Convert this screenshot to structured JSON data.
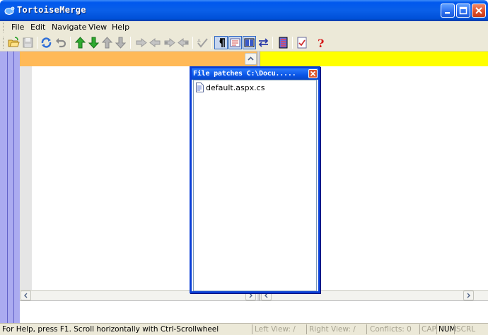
{
  "window": {
    "title": "TortoiseMerge"
  },
  "menu": {
    "items": [
      "File",
      "Edit",
      "Navigate",
      "View",
      "Help"
    ]
  },
  "toolbar": {
    "buttons": [
      "open-icon",
      "save-icon",
      "reload-icon",
      "undo-icon",
      "next-diff-icon",
      "prev-diff-icon",
      "next-conflict-icon",
      "prev-conflict-icon",
      "use-theirs-icon",
      "use-mine-icon",
      "use-theirs-before-mine-icon",
      "use-mine-before-theirs-icon",
      "mark-resolved-icon",
      "whitespace-icon",
      "inline-diff-icon",
      "two-pane-icon",
      "swap-icon",
      "settings-icon",
      "patch-list-icon",
      "help-icon"
    ]
  },
  "patch_window": {
    "title": "File patches  C:\\Docu.....",
    "files": [
      "default.aspx.cs"
    ]
  },
  "status": {
    "help_text": "For Help, press F1. Scroll horizontally with Ctrl-Scrollwheel",
    "left_view": "Left View:  /",
    "right_view": "Right View:  /",
    "conflicts": "Conflicts: 0",
    "cap": "CAP",
    "num": "NUM",
    "scrl": "SCRL"
  },
  "colors": {
    "title_bar": "#0058ee",
    "left_header": "#ffb957",
    "right_header": "#ffff00",
    "gutter": "#ababf0"
  }
}
